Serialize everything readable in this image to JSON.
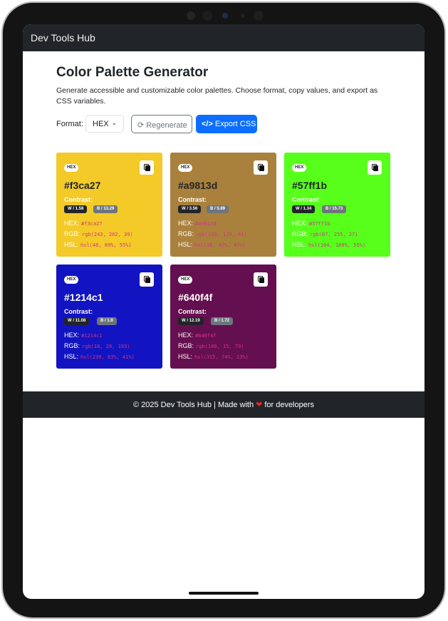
{
  "navbar": {
    "brand": "Dev Tools Hub"
  },
  "page": {
    "title": "Color Palette Generator",
    "description": "Generate accessible and customizable color palettes. Choose format, copy values, and export as CSS variables."
  },
  "controls": {
    "format_label": "Format:",
    "format_value": "HEX",
    "regenerate_label": "Regenerate",
    "export_label": "Export CSS"
  },
  "labels": {
    "badge": "HEX",
    "contrast": "Contrast:",
    "hex": "HEX:",
    "rgb": "RGB:",
    "hsl": "HSL:"
  },
  "colors": [
    {
      "hex": "#f3ca27",
      "bg": "#f3ca27",
      "text": "#212529",
      "label_text": "#ffffff",
      "w_contrast": "W / 1.58",
      "b_contrast": "B / 13.29",
      "hex_value": "#f3ca27",
      "rgb": "rgb(243, 202, 39)",
      "hsl": "hsl(48, 89%, 55%)"
    },
    {
      "hex": "#a9813d",
      "bg": "#a9813d",
      "text": "#212529",
      "label_text": "#ffffff",
      "w_contrast": "W / 3.56",
      "b_contrast": "B / 5.89",
      "hex_value": "#a9813d",
      "rgb": "rgb(169, 129, 61)",
      "hsl": "hsl(38, 47%, 45%)"
    },
    {
      "hex": "#57ff1b",
      "bg": "#57ff1b",
      "text": "#212529",
      "label_text": "#ffffff",
      "w_contrast": "W / 1.34",
      "b_contrast": "B / 15.73",
      "hex_value": "#57ff1b",
      "rgb": "rgb(87, 255, 27)",
      "hsl": "hsl(104, 100%, 55%)"
    },
    {
      "hex": "#1214c1",
      "bg": "#1214c1",
      "text": "#ffffff",
      "label_text": "#ffffff",
      "w_contrast": "W / 11.08",
      "b_contrast": "B / 1.9",
      "hex_value": "#1214c1",
      "rgb": "rgb(18, 20, 193)",
      "hsl": "hsl(239, 83%, 41%)"
    },
    {
      "hex": "#640f4f",
      "bg": "#640f4f",
      "text": "#ffffff",
      "label_text": "#ffffff",
      "w_contrast": "W / 12.19",
      "b_contrast": "B / 1.72",
      "hex_value": "#640f4f",
      "rgb": "rgb(100, 15, 79)",
      "hsl": "hsl(315, 74%, 23%)"
    }
  ],
  "footer": {
    "left": "© 2025 Dev Tools Hub | Made with",
    "right": "for developers"
  },
  "theme": {
    "primary": "#0d6efd",
    "dark": "#212529",
    "secondary": "#6c757d",
    "code": "#d63384"
  }
}
